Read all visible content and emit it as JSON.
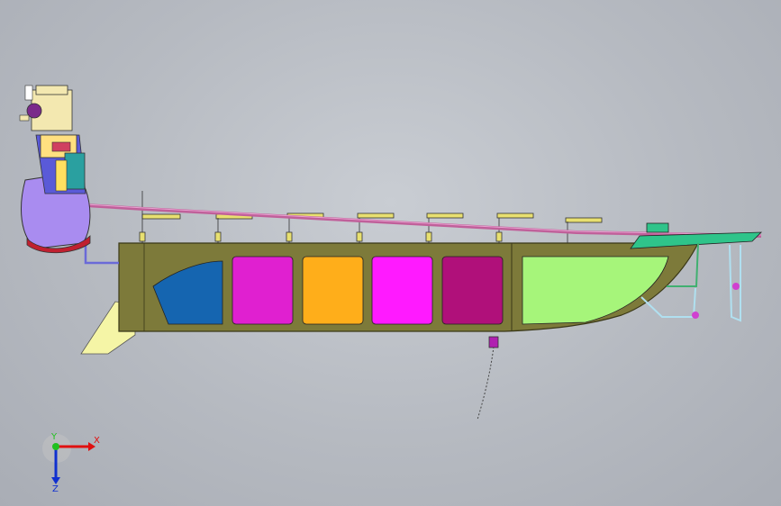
{
  "viewport": {
    "background": "#b9bdc4"
  },
  "colors": {
    "hull": "#7d7a3a",
    "hull_edge": "#3a3818",
    "compartment_blue": "#1565b0",
    "compartment_magenta": "#e020d0",
    "compartment_orange": "#ffae1a",
    "compartment_pink": "#ff1aff",
    "compartment_purple": "#b0107a",
    "compartment_green": "#a6f57a",
    "keel_fin": "#f5f5a6",
    "rail": "#c0609a",
    "engine_cowl": "#a98cf0",
    "bow_cap": "#2fc48a",
    "pipe": "#6a6ad8"
  },
  "triad": {
    "x_label": "X",
    "y_label": "Y",
    "z_label": "Z",
    "x_color": "#e01010",
    "y_color": "#20c020",
    "z_color": "#1030d0"
  },
  "icons": {
    "triad": "coordinate-axes-icon"
  }
}
